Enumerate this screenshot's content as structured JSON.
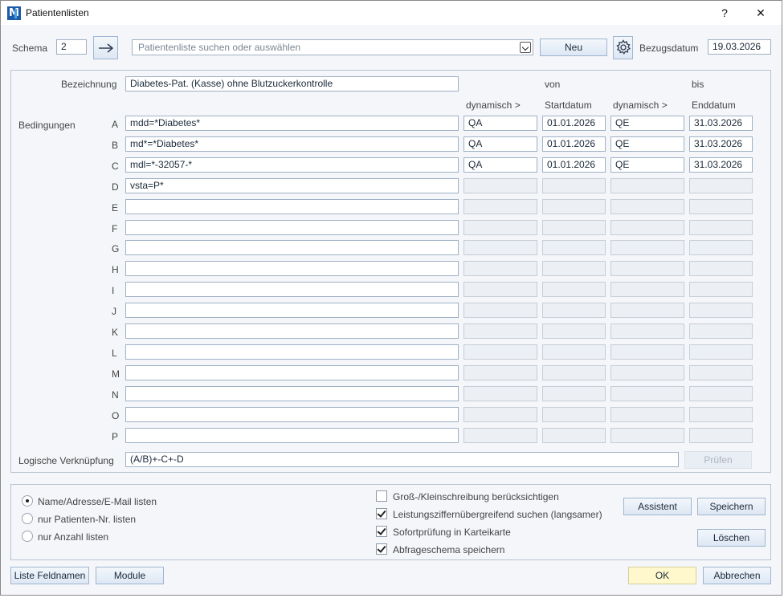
{
  "window": {
    "title": "Patientenlisten",
    "help": "?",
    "close": "✕"
  },
  "toolbar": {
    "schema_label": "Schema",
    "schema_value": "2",
    "search_placeholder": "Patientenliste suchen oder auswählen",
    "new_label": "Neu",
    "bezugsdatum_label": "Bezugsdatum",
    "bezugsdatum_value": "19.03.2026"
  },
  "form": {
    "bezeichnung_label": "Bezeichnung",
    "bezeichnung_value": "Diabetes-Pat. (Kasse) ohne Blutzuckerkontrolle",
    "bedingungen_label": "Bedingungen",
    "col_von": "von",
    "col_bis": "bis",
    "col_dyn1": "dynamisch >",
    "col_start": "Startdatum",
    "col_dyn2": "dynamisch >",
    "col_end": "Enddatum",
    "rows": [
      {
        "letter": "A",
        "cond": "mdd=*Diabetes*",
        "dyn1": "QA",
        "start": "01.01.2026",
        "dyn2": "QE",
        "end": "31.03.2026"
      },
      {
        "letter": "B",
        "cond": "md*=*Diabetes*",
        "dyn1": "QA",
        "start": "01.01.2026",
        "dyn2": "QE",
        "end": "31.03.2026"
      },
      {
        "letter": "C",
        "cond": "mdl=*-32057-*",
        "dyn1": "QA",
        "start": "01.01.2026",
        "dyn2": "QE",
        "end": "31.03.2026"
      },
      {
        "letter": "D",
        "cond": "vsta=P*",
        "dyn1": "",
        "start": "",
        "dyn2": "",
        "end": ""
      },
      {
        "letter": "E",
        "cond": "",
        "dyn1": "",
        "start": "",
        "dyn2": "",
        "end": ""
      },
      {
        "letter": "F",
        "cond": "",
        "dyn1": "",
        "start": "",
        "dyn2": "",
        "end": ""
      },
      {
        "letter": "G",
        "cond": "",
        "dyn1": "",
        "start": "",
        "dyn2": "",
        "end": ""
      },
      {
        "letter": "H",
        "cond": "",
        "dyn1": "",
        "start": "",
        "dyn2": "",
        "end": ""
      },
      {
        "letter": "I",
        "cond": "",
        "dyn1": "",
        "start": "",
        "dyn2": "",
        "end": ""
      },
      {
        "letter": "J",
        "cond": "",
        "dyn1": "",
        "start": "",
        "dyn2": "",
        "end": ""
      },
      {
        "letter": "K",
        "cond": "",
        "dyn1": "",
        "start": "",
        "dyn2": "",
        "end": ""
      },
      {
        "letter": "L",
        "cond": "",
        "dyn1": "",
        "start": "",
        "dyn2": "",
        "end": ""
      },
      {
        "letter": "M",
        "cond": "",
        "dyn1": "",
        "start": "",
        "dyn2": "",
        "end": ""
      },
      {
        "letter": "N",
        "cond": "",
        "dyn1": "",
        "start": "",
        "dyn2": "",
        "end": ""
      },
      {
        "letter": "O",
        "cond": "",
        "dyn1": "",
        "start": "",
        "dyn2": "",
        "end": ""
      },
      {
        "letter": "P",
        "cond": "",
        "dyn1": "",
        "start": "",
        "dyn2": "",
        "end": ""
      }
    ],
    "logic_label": "Logische Verknüpfung",
    "logic_value": "(A/B)+-C+-D",
    "pruefen_label": "Prüfen"
  },
  "options": {
    "radios": [
      {
        "label": "Name/Adresse/E-Mail listen",
        "checked": true
      },
      {
        "label": "nur Patienten-Nr. listen",
        "checked": false
      },
      {
        "label": "nur Anzahl listen",
        "checked": false
      }
    ],
    "checks": [
      {
        "label": "Groß-/Kleinschreibung berücksichtigen",
        "checked": false
      },
      {
        "label": "Leistungsziffernübergreifend suchen (langsamer)",
        "checked": true
      },
      {
        "label": "Sofortprüfung in Karteikarte",
        "checked": true
      },
      {
        "label": "Abfrageschema speichern",
        "checked": true
      }
    ],
    "assistent_label": "Assistent",
    "speichern_label": "Speichern",
    "loeschen_label": "Löschen"
  },
  "footer": {
    "feldnamen_label": "Liste Feldnamen",
    "module_label": "Module",
    "ok_label": "OK",
    "abbrechen_label": "Abbrechen"
  },
  "icons": {
    "arrow": "arrow-right-icon",
    "gear": "gear-icon",
    "app": "app-logo-icon"
  }
}
